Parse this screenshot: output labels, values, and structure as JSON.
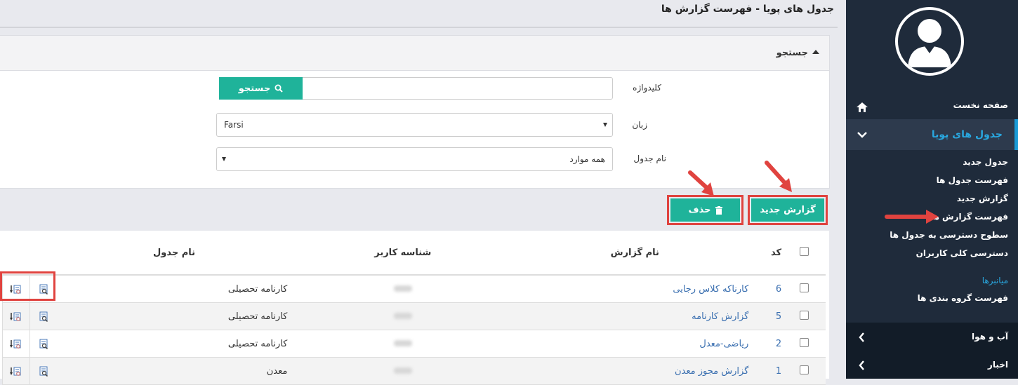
{
  "page": {
    "title": "جدول های پویا - فهرست گزارش ها"
  },
  "search": {
    "header": "جستجو",
    "keyword_label": "کلیدواژه",
    "keyword_value": "",
    "search_button": "جستجو",
    "language_label": "زبان",
    "language_value": "Farsi",
    "table_name_label": "نام جدول",
    "table_name_value": "همه موارد"
  },
  "actions": {
    "new_report": "گزارش جدید",
    "delete": "حذف"
  },
  "table": {
    "headers": {
      "code": "کد",
      "report_name": "نام گزارش",
      "user_id": "شناسه کاربر",
      "table_name": "نام جدول"
    },
    "rows": [
      {
        "code": "6",
        "report_name": "کارناکه کلاس رجایی",
        "table_name": "کارنامه تحصیلی"
      },
      {
        "code": "5",
        "report_name": "گزارش کارنامه",
        "table_name": "کارنامه تحصیلی"
      },
      {
        "code": "2",
        "report_name": "ریاضی-معدل",
        "table_name": "کارنامه تحصیلی"
      },
      {
        "code": "1",
        "report_name": "گزارش مجوز معدن",
        "table_name": "معدن"
      }
    ]
  },
  "sidebar": {
    "home": "صفحه نخست",
    "active_section": "جدول های پویا",
    "sub_items": [
      "جدول جدید",
      "فهرست جدول ها",
      "گزارش جدید",
      "فهرست گزارش ها",
      "سطوح دسترسی به جدول ها",
      "دسترسی کلی کاربران"
    ],
    "shortcuts_title": "میانبرها",
    "shortcut_item": "فهرست گروه بندی ها",
    "groups": [
      "آب و هوا",
      "اخبار"
    ]
  },
  "colors": {
    "accent": "#1fb39a",
    "sidebar_bg": "#1f2b3b",
    "highlight": "#e0433f",
    "active_bar": "#1a9bd7",
    "link": "#3a6fb0"
  }
}
